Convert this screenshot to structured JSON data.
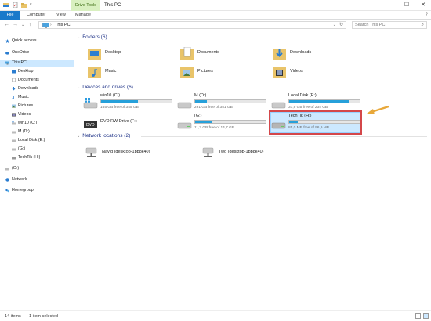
{
  "titlebar": {
    "context_tab": "Drive Tools",
    "title": "This PC",
    "minimize": "—",
    "maximize": "☐",
    "close": "✕"
  },
  "ribbon": {
    "file": "File",
    "computer": "Computer",
    "view": "View",
    "manage": "Manage",
    "help": "?"
  },
  "address": {
    "back": "←",
    "forward": "→",
    "recent": "⌄",
    "up": "↑",
    "path": "This PC",
    "refresh": "↻",
    "search_placeholder": "Search This PC",
    "search_icon": "⌕"
  },
  "nav": {
    "items": [
      {
        "label": "Quick access",
        "icon": "star-icon"
      },
      {
        "label": "OneDrive",
        "icon": "cloud-icon"
      },
      {
        "label": "This PC",
        "icon": "computer-icon"
      },
      {
        "label": "Desktop",
        "icon": "desktop-folder-icon"
      },
      {
        "label": "Documents",
        "icon": "documents-folder-icon"
      },
      {
        "label": "Downloads",
        "icon": "downloads-folder-icon"
      },
      {
        "label": "Music",
        "icon": "music-folder-icon"
      },
      {
        "label": "Pictures",
        "icon": "pictures-folder-icon"
      },
      {
        "label": "Videos",
        "icon": "videos-folder-icon"
      },
      {
        "label": "win10 (C:)",
        "icon": "windows-drive-icon"
      },
      {
        "label": "M (D:)",
        "icon": "drive-icon"
      },
      {
        "label": "Local Disk (E:)",
        "icon": "drive-icon"
      },
      {
        "label": "(G:)",
        "icon": "drive-icon"
      },
      {
        "label": "TechTik (H:)",
        "icon": "usb-drive-icon"
      },
      {
        "label": "(G:)",
        "icon": "drive-icon"
      },
      {
        "label": "Network",
        "icon": "network-icon"
      },
      {
        "label": "Homegroup",
        "icon": "homegroup-icon"
      }
    ]
  },
  "folders": {
    "header": "Folders (6)",
    "items": [
      "Desktop",
      "Documents",
      "Downloads",
      "Music",
      "Pictures",
      "Videos"
    ]
  },
  "drives": {
    "header": "Devices and drives (6)",
    "items": [
      {
        "name": "win10 (C:)",
        "free": "165 GB free of 345 GB",
        "used_fraction": 0.52
      },
      {
        "name": "M (D:)",
        "free": "291 GB free of 351 GB",
        "used_fraction": 0.17
      },
      {
        "name": "Local Disk (E:)",
        "free": "37,9 GB free of 234 GB",
        "used_fraction": 0.84
      },
      {
        "name": "DVD RW Drive (F:)",
        "free": "",
        "used_fraction": null
      },
      {
        "name": "(G:)",
        "free": "11,3 GB free of 14,7 GB",
        "used_fraction": 0.23
      },
      {
        "name": "TechTik (H:)",
        "free": "85,0 MB free of 96,9 MB",
        "used_fraction": 0.12
      }
    ]
  },
  "network": {
    "header": "Network locations (2)",
    "items": [
      "Navid (desktop-1pp8k40)",
      "Two (desktop-1pp8k40)"
    ]
  },
  "status": {
    "count": "14 items",
    "selected": "1 item selected"
  },
  "colors": {
    "accent": "#1979ca",
    "bar_fill": "#26a0da",
    "highlight": "#d4474a",
    "arrow": "#e8a83a",
    "folder": "#e9c46a"
  }
}
